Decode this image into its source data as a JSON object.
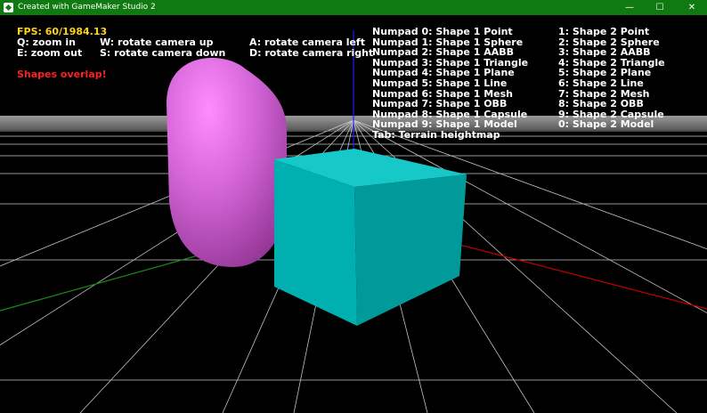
{
  "window": {
    "title": "Created with GameMaker Studio 2",
    "controls": {
      "minimize": "—",
      "maximize": "☐",
      "close": "✕"
    }
  },
  "hud": {
    "fps": "FPS: 60/1984.13",
    "controls": [
      "Q: zoom in",
      "E: zoom out",
      "W: rotate camera up",
      "S: rotate camera down",
      "A: rotate camera left",
      "D: rotate camera right"
    ],
    "status": "Shapes overlap!",
    "shape1_keys": [
      "Numpad 0: Shape 1 Point",
      "Numpad 1: Shape 1 Sphere",
      "Numpad 2: Shape 1 AABB",
      "Numpad 3: Shape 1 Triangle",
      "Numpad 4: Shape 1 Plane",
      "Numpad 5: Shape 1 Line",
      "Numpad 6: Shape 1 Mesh",
      "Numpad 7: Shape 1 OBB",
      "Numpad 8: Shape 1 Capsule",
      "Numpad 9: Shape 1 Model",
      "Tab: Terrain heightmap"
    ],
    "shape2_keys": [
      "1: Shape 2 Point",
      "2: Shape 2 Sphere",
      "3: Shape 2 AABB",
      "4: Shape 2 Triangle",
      "5: Shape 2 Plane",
      "6: Shape 2 Line",
      "7: Shape 2 Mesh",
      "8: Shape 2 OBB",
      "9: Shape 2 Capsule",
      "0: Shape 2 Model"
    ]
  },
  "scene": {
    "capsule_color": "#d264d6",
    "box_color": "#00b4b4",
    "x_axis_color": "#c00000",
    "y_axis_color": "#1a8a1a",
    "z_axis_color": "#1a1aff"
  }
}
